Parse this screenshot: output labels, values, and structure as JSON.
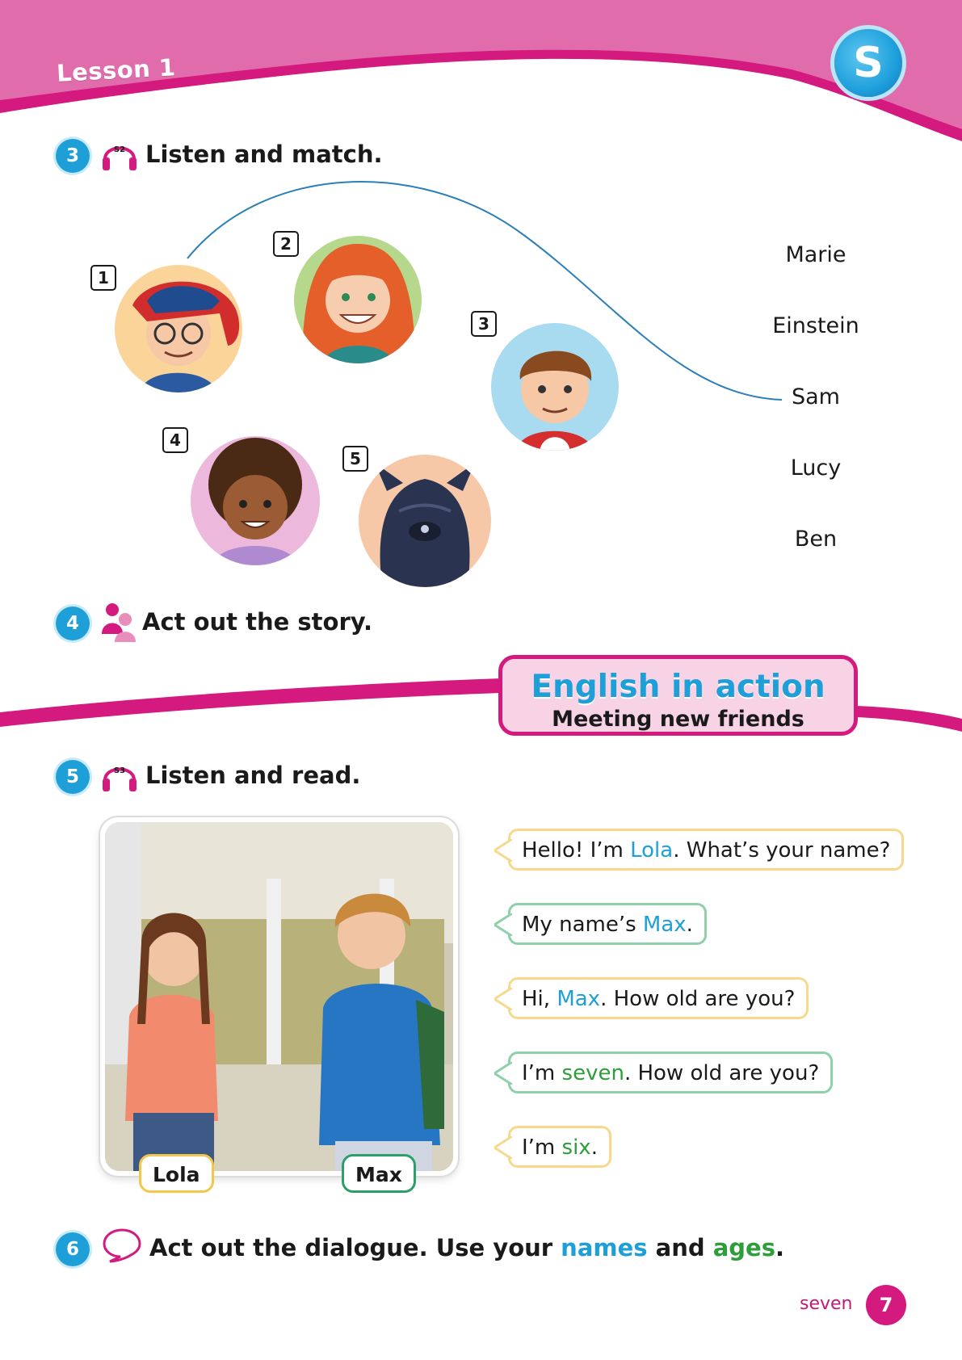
{
  "header": {
    "lesson": "Lesson 1",
    "badge": "S"
  },
  "ex3": {
    "number": "3",
    "audio": "S2",
    "title": "Listen and match.",
    "characters": [
      {
        "num": "1"
      },
      {
        "num": "2"
      },
      {
        "num": "3"
      },
      {
        "num": "4"
      },
      {
        "num": "5"
      }
    ],
    "names": [
      "Marie",
      "Einstein",
      "Sam",
      "Lucy",
      "Ben"
    ]
  },
  "ex4": {
    "number": "4",
    "title": "Act out the story."
  },
  "banner": {
    "title": "English in action",
    "subtitle": "Meeting new friends"
  },
  "ex5": {
    "number": "5",
    "audio": "S3",
    "title": "Listen and read.",
    "tags": {
      "girl": "Lola",
      "boy": "Max"
    },
    "dialogue": [
      {
        "parts": [
          "Hello! I’m ",
          "Lola",
          ". What’s your name?"
        ]
      },
      {
        "parts": [
          "My name’s ",
          "Max",
          "."
        ]
      },
      {
        "parts": [
          "Hi, ",
          "Max",
          ". How old are you?"
        ]
      },
      {
        "parts": [
          "I’m ",
          "seven",
          ". How old are you?"
        ]
      },
      {
        "parts": [
          "I’m ",
          "six",
          "."
        ]
      }
    ]
  },
  "ex6": {
    "number": "6",
    "title_parts": [
      "Act out the dialogue. Use your ",
      "names",
      " and ",
      "ages",
      "."
    ]
  },
  "footer": {
    "page_word": "seven",
    "page_number": "7"
  },
  "colors": {
    "magenta": "#d4197f",
    "pink": "#e46aad",
    "blue": "#1f9fd8",
    "green": "#2e9e3a"
  }
}
